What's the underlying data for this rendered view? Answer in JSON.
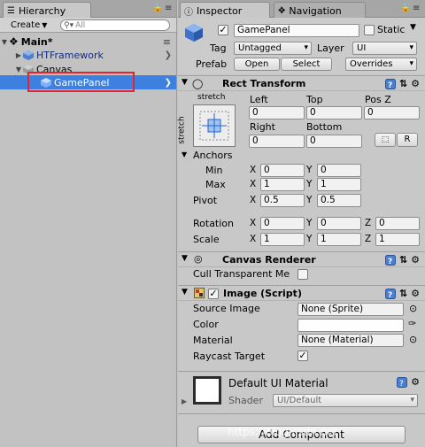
{
  "hierarchy": {
    "tab_label": "Hierarchy",
    "create_label": "Create",
    "search_placeholder": "All",
    "scene_name": "Main*",
    "items": [
      {
        "label": "HTFramework"
      },
      {
        "label": "Canvas"
      },
      {
        "label": "GamePanel"
      }
    ]
  },
  "inspector": {
    "tab_label": "Inspector",
    "nav_tab_label": "Navigation",
    "object_name": "GamePanel",
    "static_label": "Static",
    "tag_label": "Tag",
    "tag_value": "Untagged",
    "layer_label": "Layer",
    "layer_value": "UI",
    "prefab_label": "Prefab",
    "prefab_open": "Open",
    "prefab_select": "Select",
    "prefab_overrides": "Overrides"
  },
  "rect_transform": {
    "title": "Rect Transform",
    "anchor_preset_top": "stretch",
    "anchor_preset_side": "stretch",
    "col_left": "Left",
    "col_top": "Top",
    "col_posz": "Pos Z",
    "left": "0",
    "top": "0",
    "posz": "0",
    "col_right": "Right",
    "col_bottom": "Bottom",
    "right": "0",
    "bottom": "0",
    "r_button": "R",
    "anchors_label": "Anchors",
    "min_label": "Min",
    "max_label": "Max",
    "min_x": "0",
    "min_y": "0",
    "max_x": "1",
    "max_y": "1",
    "pivot_label": "Pivot",
    "pivot_x": "0.5",
    "pivot_y": "0.5",
    "rotation_label": "Rotation",
    "rot_x": "0",
    "rot_y": "0",
    "rot_z": "0",
    "scale_label": "Scale",
    "scale_x": "1",
    "scale_y": "1",
    "scale_z": "1",
    "x": "X",
    "y": "Y",
    "z": "Z"
  },
  "canvas_renderer": {
    "title": "Canvas Renderer",
    "cull_label": "Cull Transparent Me"
  },
  "image_script": {
    "title": "Image (Script)",
    "source_label": "Source Image",
    "source_value": "None (Sprite)",
    "color_label": "Color",
    "material_label": "Material",
    "material_value": "None (Material)",
    "raycast_label": "Raycast Target"
  },
  "material": {
    "name": "Default UI Material",
    "shader_label": "Shader",
    "shader_value": "UI/Default"
  },
  "add_component_label": "Add Component",
  "watermark": "https://blog.csdn.net",
  "colors": {
    "selection": "#3d80df",
    "highlight_box": "#e8212e",
    "panel_bg": "#c8c8c8"
  }
}
